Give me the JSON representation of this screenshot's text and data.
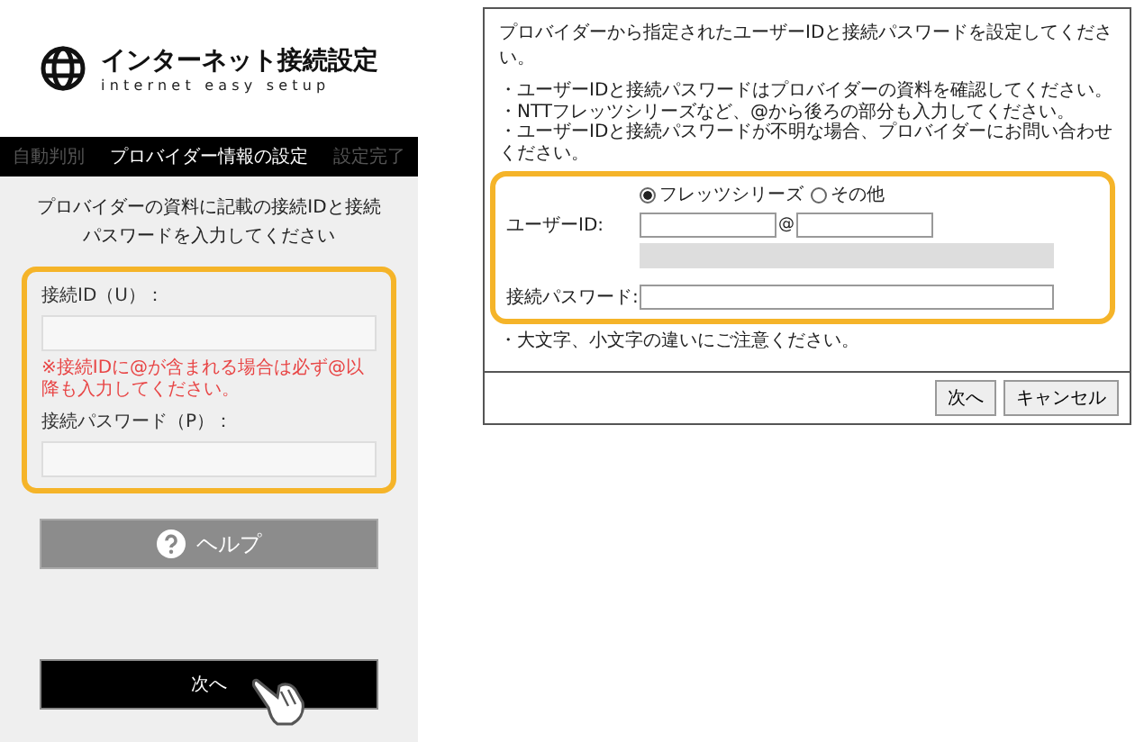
{
  "setup_panel": {
    "title": "インターネット接続設定",
    "subtitle": "internet easy setup",
    "steps": [
      {
        "label": "自動判別",
        "selected": false
      },
      {
        "label": "プロバイダー情報の設定",
        "selected": true
      },
      {
        "label": "設定完了",
        "selected": false
      }
    ],
    "instruction": "プロバイダーの資料に記載の接続IDと接続パスワードを入力してください",
    "fields": [
      {
        "label": "接続ID（U）：",
        "note": "※接続IDに@が含まれる場合は必ず@以降も入力してください。"
      },
      {
        "label": "接続パスワード（P）："
      }
    ],
    "help_button": "ヘルプ",
    "next_button": "次へ"
  },
  "router_dialog": {
    "intro": "プロバイダーから指定されたユーザーIDと接続パスワードを設定してください。",
    "notes": [
      "・ユーザーIDと接続パスワードはプロバイダーの資料を確認してください。",
      "・NTTフレッツシリーズなど、@から後ろの部分も入力してください。",
      "・ユーザーIDと接続パスワードが不明な場合、プロバイダーにお問い合わせください。"
    ],
    "user_id_label": "ユーザーID:",
    "at_sign": "@",
    "radio_options": [
      {
        "label": "フレッツシリーズ",
        "selected": true
      },
      {
        "label": "その他",
        "selected": false
      }
    ],
    "password_label": "接続パスワード:",
    "footnote": "・大文字、小文字の違いにご注意ください。",
    "buttons": [
      "次へ",
      "キャンセル"
    ]
  }
}
